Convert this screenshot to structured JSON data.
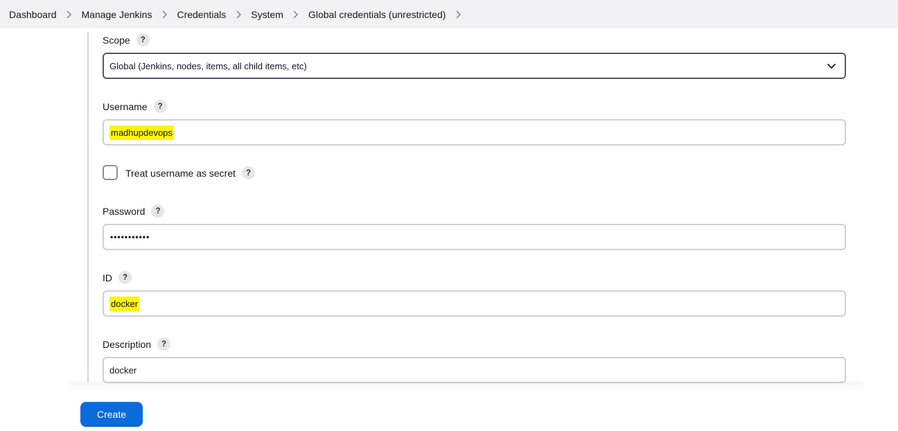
{
  "breadcrumb": {
    "items": [
      "Dashboard",
      "Manage Jenkins",
      "Credentials",
      "System",
      "Global credentials (unrestricted)"
    ]
  },
  "form": {
    "scope": {
      "label": "Scope",
      "value": "Global (Jenkins, nodes, items, all child items, etc)"
    },
    "username": {
      "label": "Username",
      "value": "madhupdevops"
    },
    "treat_username_secret": {
      "label": "Treat username as secret",
      "checked": false
    },
    "password": {
      "label": "Password",
      "masked_value": "•••••••••••"
    },
    "id": {
      "label": "ID",
      "value": "docker"
    },
    "description": {
      "label": "Description",
      "value": "docker"
    },
    "help_glyph": "?"
  },
  "actions": {
    "create_label": "Create"
  },
  "colors": {
    "primary_button": "#0b6bd8",
    "highlight": "#fcf50a",
    "breadcrumb_bg": "#f2f2f5"
  },
  "icons": {
    "breadcrumb_separator": "chevron-right-icon",
    "select_indicator": "chevron-down-icon",
    "help": "help-icon"
  }
}
